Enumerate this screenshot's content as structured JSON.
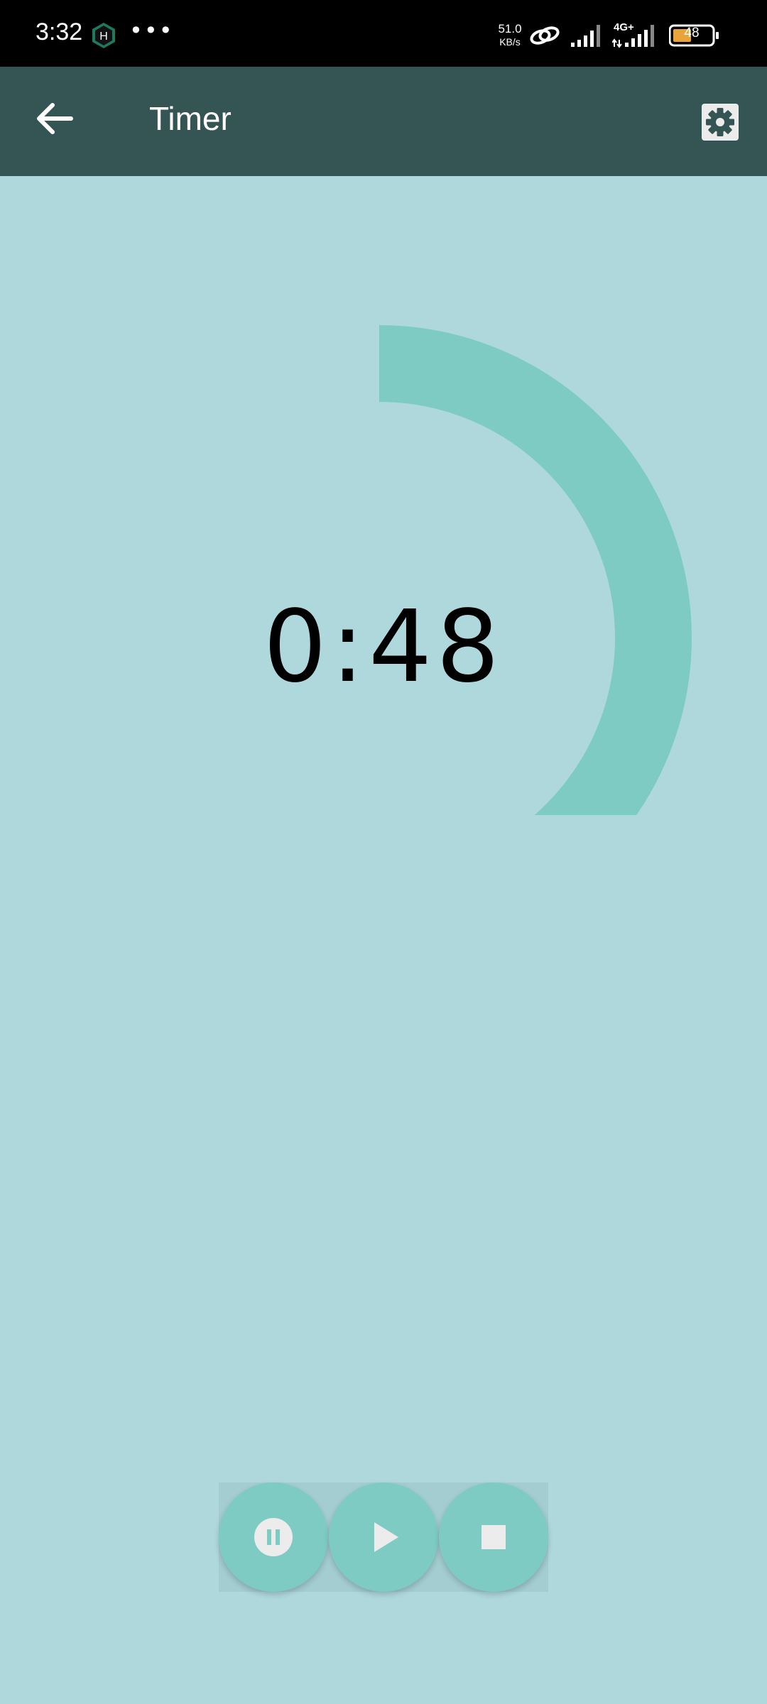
{
  "status_bar": {
    "time": "3:32",
    "net_speed_value": "51.0",
    "net_speed_unit": "KB/s",
    "network_type": "4G+",
    "battery_level": "48",
    "icons": [
      "hd-icon",
      "more-dots-icon",
      "link-icon",
      "signal-icon",
      "signal-4g-icon",
      "battery-icon"
    ]
  },
  "app_bar": {
    "title": "Timer",
    "back_icon": "arrow-left-icon",
    "settings_icon": "gear-icon"
  },
  "timer": {
    "display": "0:48",
    "minutes": 0,
    "seconds": 48,
    "arc_color": "#7ecbc4"
  },
  "controls": {
    "pause_icon": "pause-icon",
    "play_icon": "play-icon",
    "stop_icon": "stop-icon"
  },
  "colors": {
    "background": "#afd8dc",
    "app_bar": "#355454",
    "accent": "#7ecbc4"
  }
}
